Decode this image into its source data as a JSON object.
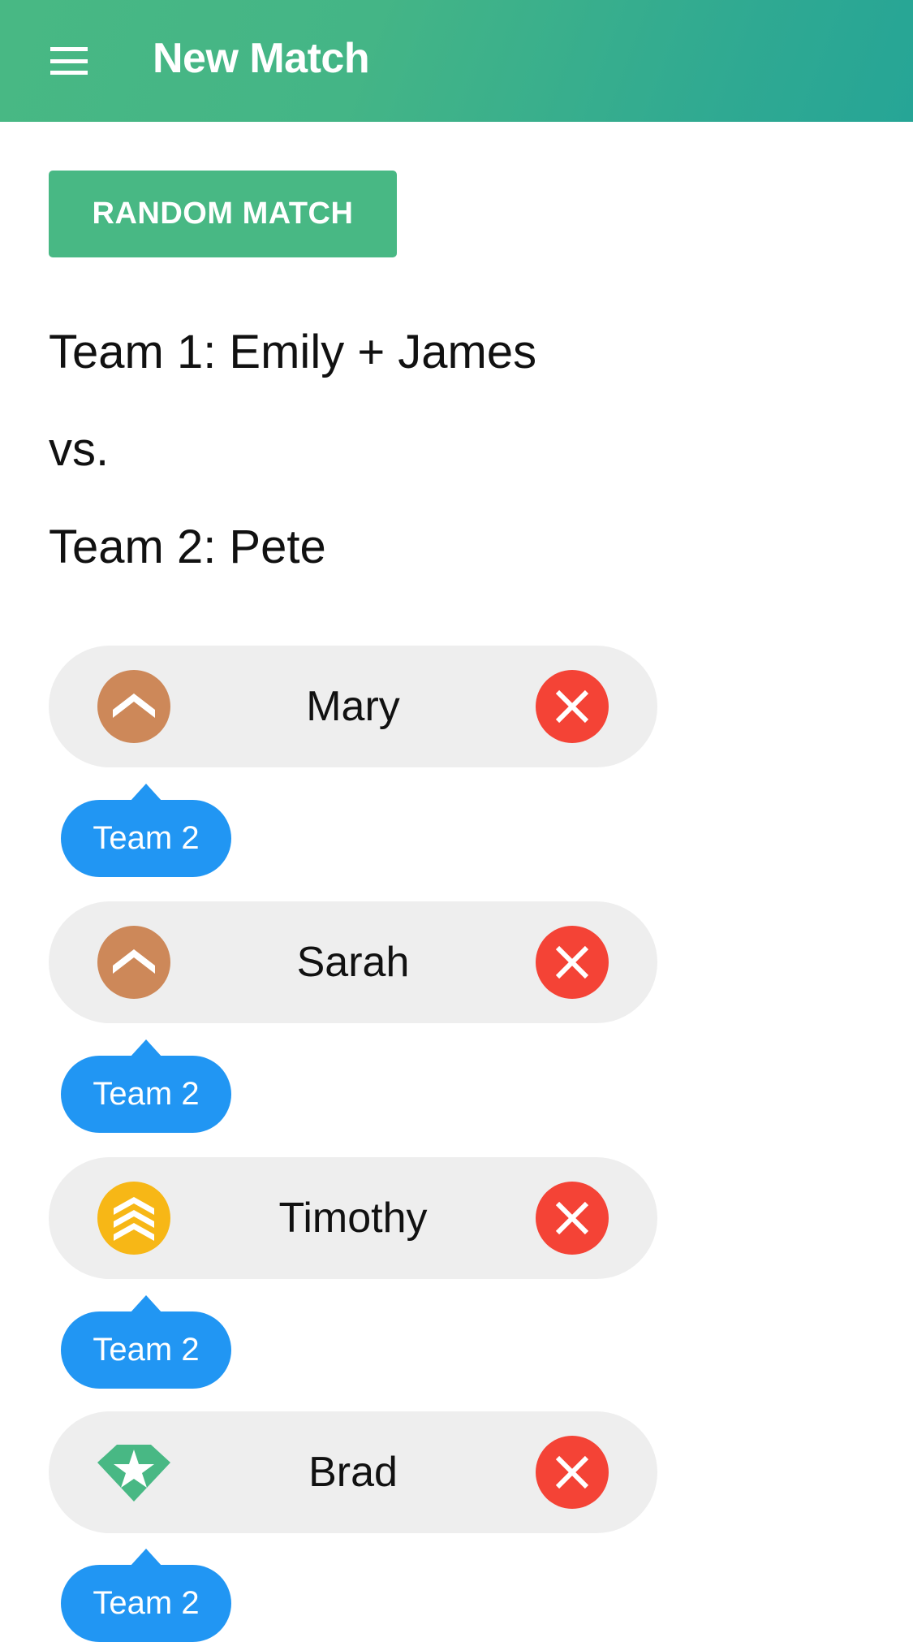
{
  "appbar": {
    "title": "New Match",
    "menu_icon": "hamburger-menu-icon",
    "gradient_colors": [
      "#48b884",
      "#26a596"
    ]
  },
  "random_button": {
    "label": "RANDOM MATCH",
    "color": "#48b884"
  },
  "match": {
    "team1": "Team 1: Emily + James",
    "vs": "vs.",
    "team2": "Team 2: Pete"
  },
  "players": [
    {
      "name": "Mary",
      "rank_icon": "chevron-single-rank-icon",
      "rank_color": "#cd8859",
      "team_label": "Team 2"
    },
    {
      "name": "Sarah",
      "rank_icon": "chevron-single-rank-icon",
      "rank_color": "#cd8859",
      "team_label": "Team 2"
    },
    {
      "name": "Timothy",
      "rank_icon": "chevron-triple-rank-icon",
      "rank_color": "#f7b716",
      "team_label": "Team 2"
    },
    {
      "name": "Brad",
      "rank_icon": "diamond-star-rank-icon",
      "rank_color": "#48b884",
      "team_label": "Team 2"
    }
  ],
  "colors": {
    "remove": "#f44336",
    "team_chip": "#2196f3",
    "player_row_bg": "#eeeeee"
  }
}
